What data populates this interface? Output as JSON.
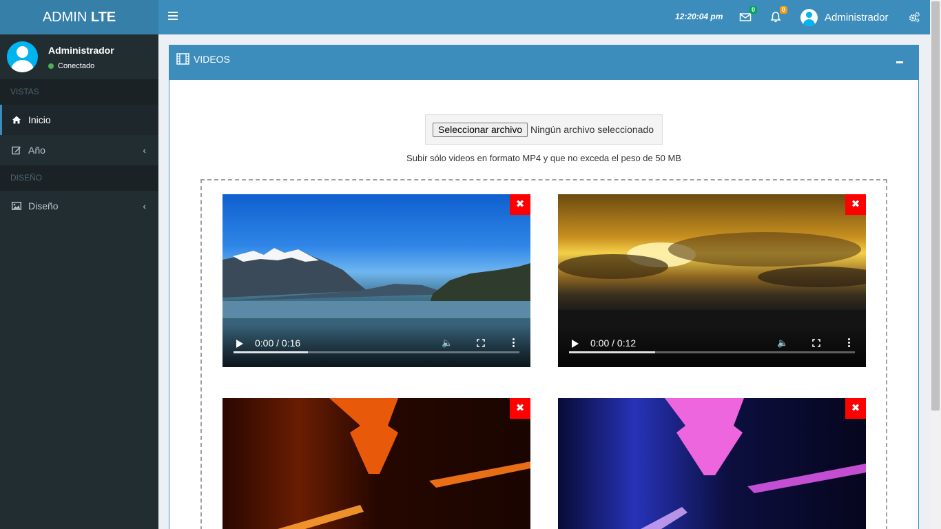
{
  "header": {
    "logo_normal": "ADMIN ",
    "logo_bold": "LTE",
    "clock": "12:20:04 pm",
    "messages_count": "0",
    "notifications_count": "0",
    "user_name": "Administrador"
  },
  "sidebar": {
    "user_name": "Administrador",
    "user_status": "Conectado",
    "sections": [
      {
        "header": "VISTAS",
        "items": [
          {
            "label": "Inicio",
            "icon": "home-icon",
            "active": true
          },
          {
            "label": "Año",
            "icon": "edit-icon",
            "has_submenu": true
          }
        ]
      },
      {
        "header": "DISEÑO",
        "items": [
          {
            "label": "Diseño",
            "icon": "image-icon",
            "has_submenu": true
          }
        ]
      }
    ]
  },
  "videos_box": {
    "title": "VIDEOS",
    "file_button": "Seleccionar archivo",
    "file_status": "Ningún archivo seleccionado",
    "hint": "Subir sólo videos en formato MP4 y que no exceda el peso de 50 MB",
    "delete_symbol": "✖",
    "videos": [
      {
        "time": "0:00 / 0:16",
        "buffered": 0.26
      },
      {
        "time": "0:00 / 0:12",
        "buffered": 0.3
      },
      {
        "time": "",
        "buffered": 0
      },
      {
        "time": "",
        "buffered": 0
      }
    ]
  },
  "colors": {
    "header": "#3c8dbc",
    "logo": "#367fa9",
    "sidebar": "#222d32",
    "delete": "#ff0000"
  }
}
